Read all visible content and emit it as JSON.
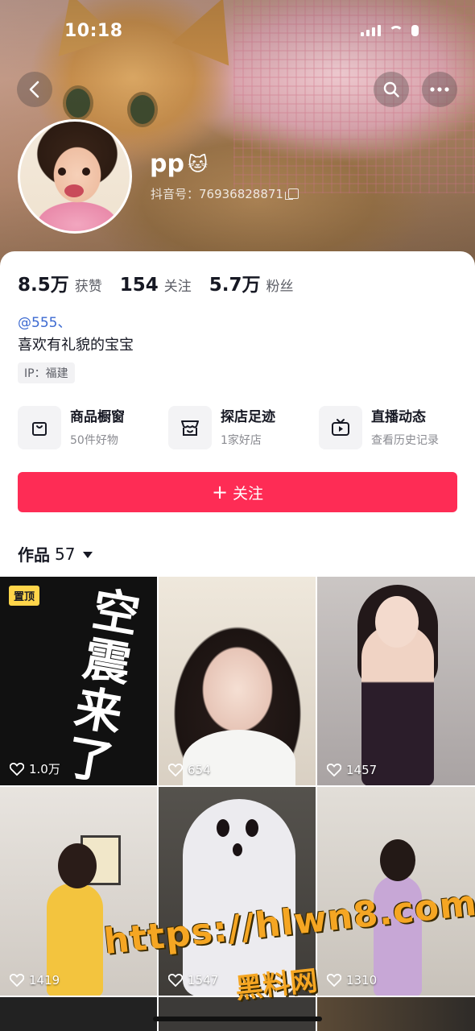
{
  "status_bar": {
    "time": "10:18"
  },
  "profile": {
    "nickname": "pp",
    "nickname_emoji": "🐱",
    "douyin_id": "抖音号：76936828871",
    "stats": [
      {
        "num": "8.5万",
        "label": "获赞"
      },
      {
        "num": "154",
        "label": "关注"
      },
      {
        "num": "5.7万",
        "label": "粉丝"
      }
    ],
    "handle": "@555、",
    "bio": "喜欢有礼貌的宝宝",
    "ip": "IP：福建"
  },
  "features": [
    {
      "icon": "shopping-bag-icon",
      "title": "商品橱窗",
      "sub": "50件好物"
    },
    {
      "icon": "store-icon",
      "title": "探店足迹",
      "sub": "1家好店"
    },
    {
      "icon": "tv-live-icon",
      "title": "直播动态",
      "sub": "查看历史记录"
    }
  ],
  "follow_button": {
    "label": "关注",
    "color": "#fe2c55"
  },
  "works": {
    "label": "作品",
    "count": "57"
  },
  "grid": [
    {
      "likes": "1.0万",
      "pinned": "置顶",
      "caption": "空震来了"
    },
    {
      "likes": "654"
    },
    {
      "likes": "1457"
    },
    {
      "likes": "1419"
    },
    {
      "likes": "1547"
    },
    {
      "likes": "1310"
    }
  ],
  "watermark": {
    "url": "https://hlwn8.com",
    "text": "黑料网"
  }
}
